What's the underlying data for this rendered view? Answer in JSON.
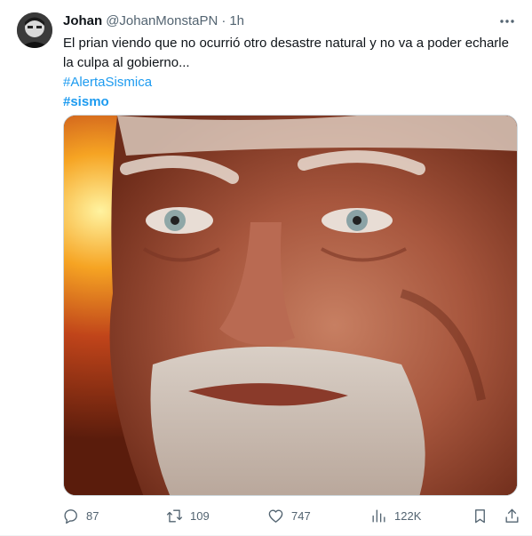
{
  "tweet": {
    "author_name": "Johan",
    "author_handle": "@JohanMonstaPN",
    "separator": "·",
    "time": "1h",
    "text": "El prian viendo que no ocurrió otro desastre natural y no va a poder echarle la culpa al gobierno...",
    "hashtags": [
      "#AlertaSismica",
      "#sismo"
    ],
    "more_icon": "ellipsis-icon",
    "media_description_icon": "meme-photo"
  },
  "actions": {
    "reply": {
      "icon": "reply-icon",
      "count": "87"
    },
    "retweet": {
      "icon": "retweet-icon",
      "count": "109"
    },
    "like": {
      "icon": "heart-icon",
      "count": "747"
    },
    "views": {
      "icon": "views-icon",
      "count": "122K"
    },
    "bookmark": {
      "icon": "bookmark-icon"
    },
    "share": {
      "icon": "share-icon"
    }
  },
  "colors": {
    "text": "#0f1419",
    "secondary": "#536471",
    "link": "#1d9bf0",
    "border": "#cfd9de"
  }
}
